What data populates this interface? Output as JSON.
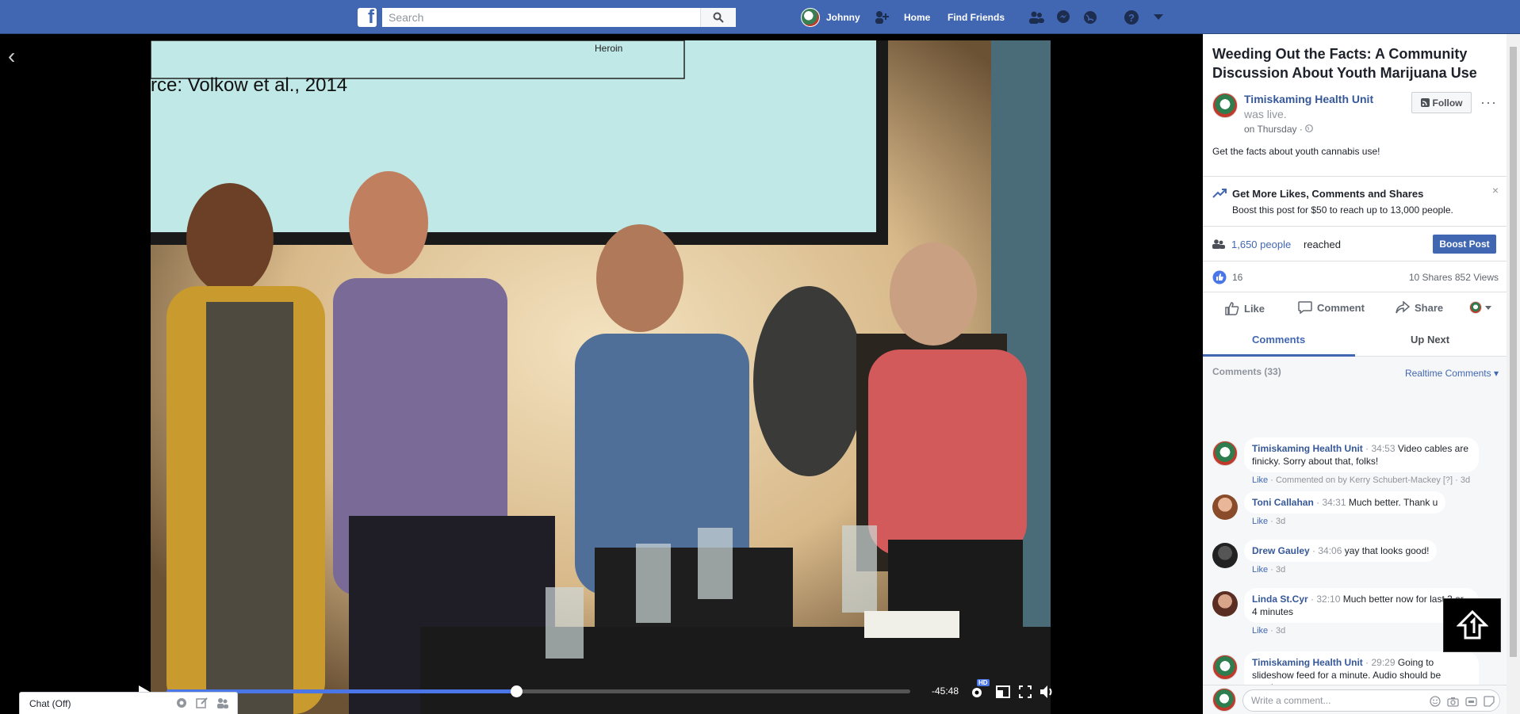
{
  "topbar": {
    "logo_letter": "f",
    "search_placeholder": "Search",
    "user_name": "Johnny",
    "home_label": "Home",
    "find_friends_label": "Find Friends"
  },
  "video": {
    "slide_text": "rce: Volkow et al., 2014",
    "slide_small_text": "Heroin",
    "progress": 0.47,
    "time_left": "-45:48",
    "hd_badge": "HD"
  },
  "chat": {
    "label": "Chat (Off)"
  },
  "post": {
    "title": "Weeding Out the Facts: A Community Discussion About Youth Marijuana Use",
    "author": "Timiskaming Health Unit",
    "status": "was live.",
    "time": "on Thursday · ",
    "follow_label": "Follow",
    "more_label": "···",
    "description": "Get the facts about youth cannabis use!"
  },
  "boost": {
    "title": "Get More Likes, Comments and Shares",
    "subtitle": "Boost this post for $50 to reach up to 13,000 people.",
    "close": "×",
    "reach_count": "1,650 people",
    "reach_label": "reached",
    "boost_button": "Boost Post"
  },
  "stats": {
    "likes": "16",
    "shares_views": "10 Shares  852 Views"
  },
  "actions": {
    "like": "Like",
    "comment": "Comment",
    "share": "Share"
  },
  "tabs": {
    "comments": "Comments",
    "up_next": "Up Next"
  },
  "comments_header": {
    "count": "Comments (33)",
    "realtime": "Realtime Comments ▾"
  },
  "comments": [
    {
      "name": "Timiskaming Health Unit",
      "time": " · 34:53 ",
      "text": "Video cables are finicky. Sorry about that, folks!",
      "like": "Like",
      "meta": " · Commented on by Kerry Schubert-Mackey [?] · 3d"
    },
    {
      "name": "Toni Callahan",
      "time": " · 34:31 ",
      "text": "Much better. Thank u",
      "like": "Like",
      "meta": " · 3d"
    },
    {
      "name": "Drew Gauley",
      "time": " · 34:06 ",
      "text": "yay that looks good!",
      "like": "Like",
      "meta": " · 3d"
    },
    {
      "name": "Linda St.Cyr",
      "time": " · 32:10 ",
      "text": "Much better now for last 3 or 4 minutes",
      "like": "Like",
      "meta": " · 3d"
    },
    {
      "name": "Timiskaming Health Unit",
      "time": " · 29:29 ",
      "text": "Going to slideshow feed for a minute. Audio should be running...",
      "like": "",
      "meta": ""
    }
  ],
  "write_comment": {
    "placeholder": "Write a comment..."
  }
}
